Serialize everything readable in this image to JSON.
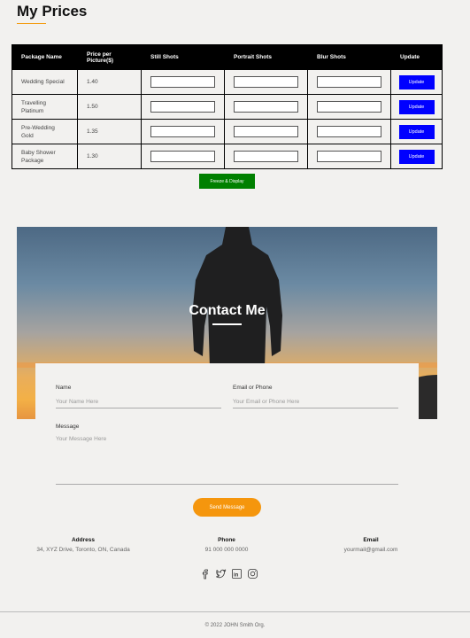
{
  "page": {
    "title": "My Prices"
  },
  "prices_table": {
    "headers": [
      "Package Name",
      "Price per Picture($)",
      "Still Shots",
      "Portrait Shots",
      "Blur Shots",
      "Update"
    ],
    "rows": [
      {
        "name": "Wedding Special",
        "price": "1.40",
        "update_label": "Update"
      },
      {
        "name": "Travelling Platinum",
        "price": "1.50",
        "update_label": "Update"
      },
      {
        "name": "Pre-Wedding Gold",
        "price": "1.35",
        "update_label": "Update"
      },
      {
        "name": "Baby Shower Package",
        "price": "1.30",
        "update_label": "Update"
      }
    ]
  },
  "freeze_button": {
    "label": "Freeze & Display"
  },
  "contact": {
    "title": "Contact Me",
    "name_label": "Name",
    "name_placeholder": "Your Name Here",
    "email_label": "Email or Phone",
    "email_placeholder": "Your Email or Phone Here",
    "message_label": "Message",
    "message_placeholder": "Your Message Here",
    "send_label": "Send Message"
  },
  "info": {
    "address_heading": "Address",
    "address_value": "34, XYZ Drive, Toronto, ON, Canada",
    "phone_heading": "Phone",
    "phone_value": "91 000 000 0000",
    "email_heading": "Email",
    "email_value": "yourmail@gmail.com"
  },
  "socials": [
    "facebook-icon",
    "twitter-icon",
    "linkedin-icon",
    "instagram-icon"
  ],
  "footer": {
    "text": "© 2022 JOHN Smith Org."
  },
  "colors": {
    "accent": "#f39c12",
    "update_button": "#0000ff",
    "freeze_button": "#008000",
    "send_button": "#f5960d"
  }
}
